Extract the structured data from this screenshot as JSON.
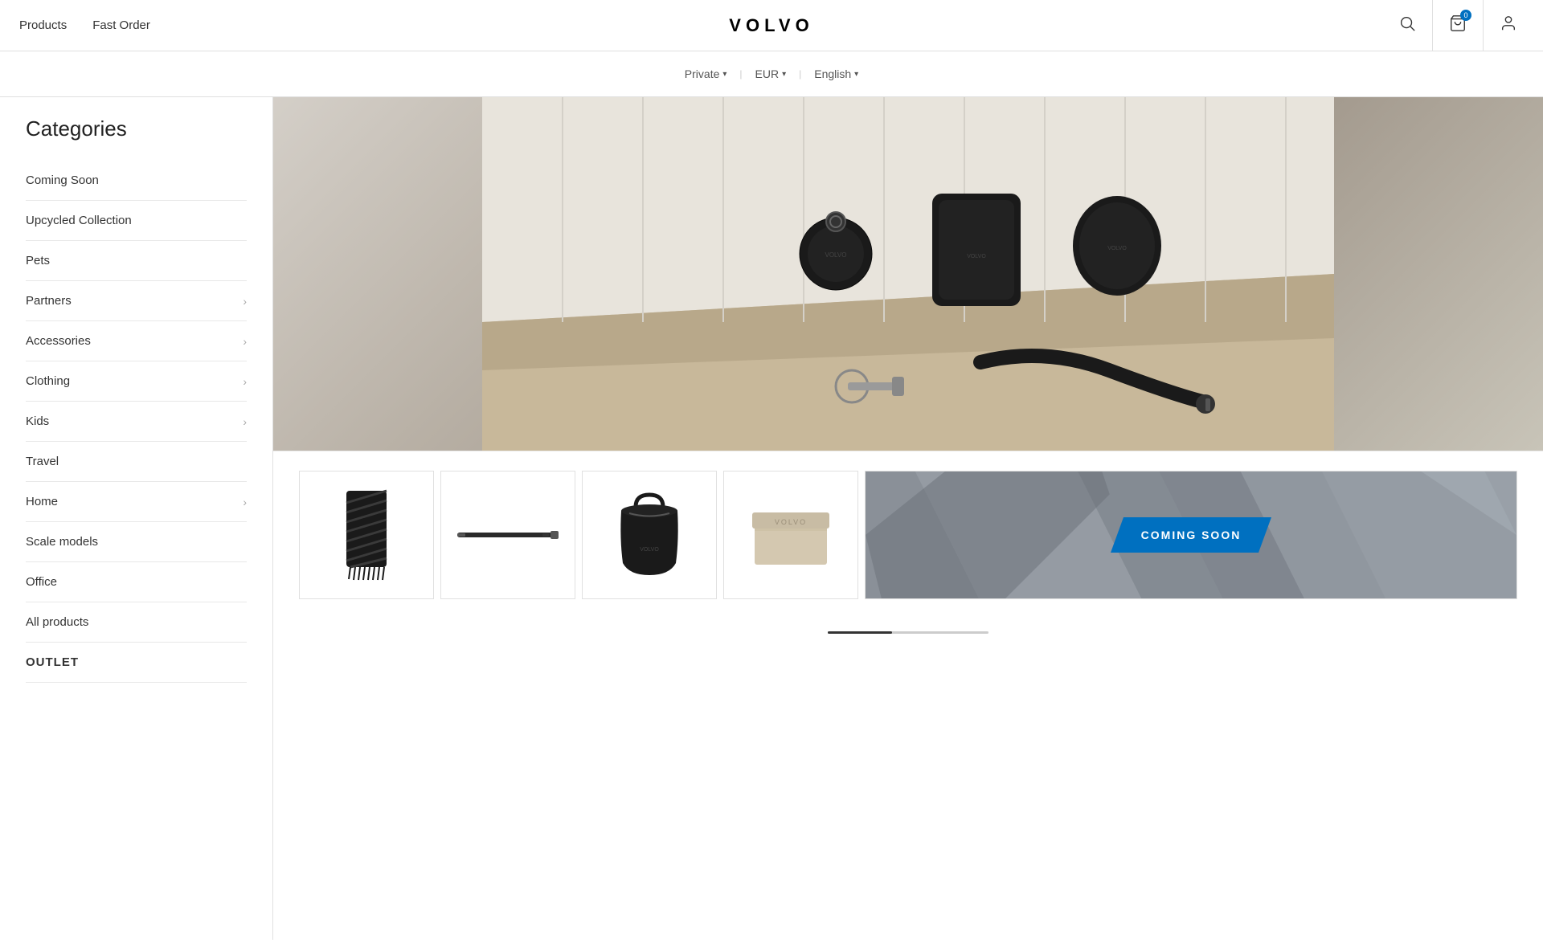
{
  "header": {
    "nav_products": "Products",
    "nav_fast_order": "Fast Order",
    "logo": "VOLVO",
    "cart_count": "0"
  },
  "sub_header": {
    "private_label": "Private",
    "eur_label": "EUR",
    "english_label": "English"
  },
  "sidebar": {
    "title": "Categories",
    "items": [
      {
        "label": "Coming Soon",
        "has_chevron": false
      },
      {
        "label": "Upcycled Collection",
        "has_chevron": false
      },
      {
        "label": "Pets",
        "has_chevron": false
      },
      {
        "label": "Partners",
        "has_chevron": true
      },
      {
        "label": "Accessories",
        "has_chevron": true
      },
      {
        "label": "Clothing",
        "has_chevron": true
      },
      {
        "label": "Kids",
        "has_chevron": true
      },
      {
        "label": "Travel",
        "has_chevron": false
      },
      {
        "label": "Home",
        "has_chevron": true
      },
      {
        "label": "Scale models",
        "has_chevron": false
      },
      {
        "label": "Office",
        "has_chevron": false
      },
      {
        "label": "All products",
        "has_chevron": false
      }
    ],
    "outlet_label": "OUTLET"
  },
  "coming_soon_banner": "COMING SOON",
  "scroll_indicator": "scroll"
}
